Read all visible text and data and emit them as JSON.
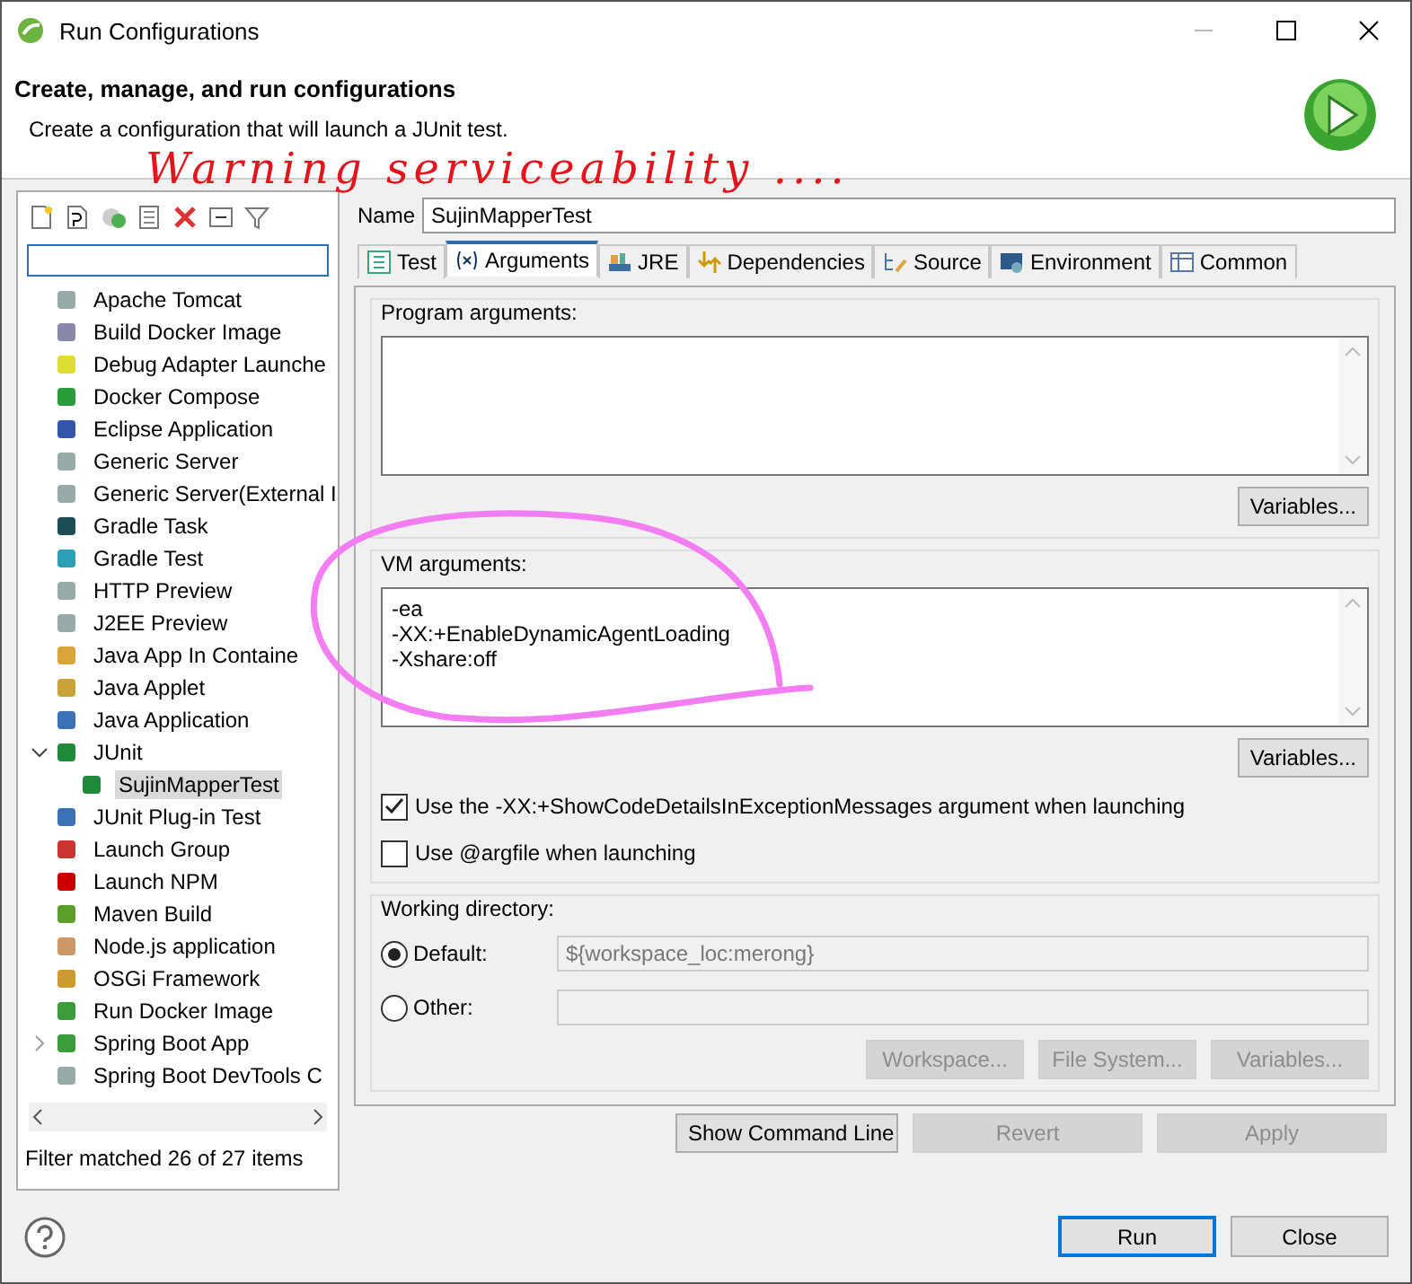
{
  "window": {
    "title": "Run Configurations"
  },
  "header": {
    "title": "Create, manage, and run configurations",
    "subtitle": "Create a configuration that will launch a JUnit test."
  },
  "sidebar": {
    "items": [
      {
        "label": "Apache Tomcat",
        "selected": false
      },
      {
        "label": "Build Docker Image",
        "selected": false
      },
      {
        "label": "Debug Adapter Launche",
        "selected": false
      },
      {
        "label": "Docker Compose",
        "selected": false
      },
      {
        "label": "Eclipse Application",
        "selected": false
      },
      {
        "label": "Generic Server",
        "selected": false
      },
      {
        "label": "Generic Server(External I",
        "selected": false
      },
      {
        "label": "Gradle Task",
        "selected": false
      },
      {
        "label": "Gradle Test",
        "selected": false
      },
      {
        "label": "HTTP Preview",
        "selected": false
      },
      {
        "label": "J2EE Preview",
        "selected": false
      },
      {
        "label": "Java App In Containe",
        "selected": false
      },
      {
        "label": "Java Applet",
        "selected": false
      },
      {
        "label": "Java Application",
        "selected": false
      },
      {
        "label": "JUnit",
        "selected": false,
        "expanded": true,
        "children": [
          {
            "label": "SujinMapperTest",
            "selected": true
          }
        ]
      },
      {
        "label": "JUnit Plug-in Test",
        "selected": false
      },
      {
        "label": "Launch Group",
        "selected": false
      },
      {
        "label": "Launch NPM",
        "selected": false
      },
      {
        "label": "Maven Build",
        "selected": false
      },
      {
        "label": "Node.js application",
        "selected": false
      },
      {
        "label": "OSGi Framework",
        "selected": false
      },
      {
        "label": "Run Docker Image",
        "selected": false
      },
      {
        "label": "Spring Boot App",
        "selected": false,
        "expanded": false
      },
      {
        "label": "Spring Boot DevTools C",
        "selected": false
      }
    ],
    "status": "Filter matched 26 of 27 items"
  },
  "editor": {
    "name_label": "Name",
    "name_value": "SujinMapperTest",
    "tabs": [
      {
        "label": "Test",
        "selected": false
      },
      {
        "label": "Arguments",
        "selected": true
      },
      {
        "label": "JRE",
        "selected": false
      },
      {
        "label": "Dependencies",
        "selected": false
      },
      {
        "label": "Source",
        "selected": false
      },
      {
        "label": "Environment",
        "selected": false
      },
      {
        "label": "Common",
        "selected": false
      }
    ],
    "program_arguments": {
      "label": "Program arguments:",
      "button": "Variables..."
    },
    "vm_arguments": {
      "label": "VM arguments:",
      "value": "-ea\n-XX:+EnableDynamicAgentLoading\n-Xshare:off",
      "button": "Variables..."
    },
    "options": [
      {
        "label": "Use the -XX:+ShowCodeDetailsInExceptionMessages argument when launching",
        "checked": true
      },
      {
        "label": "Use @argfile when launching",
        "checked": false
      }
    ],
    "working_directory": {
      "label": "Working directory:",
      "choices": [
        {
          "label": "Default:",
          "selected": true,
          "value": "${workspace_loc:merong}"
        },
        {
          "label": "Other:",
          "selected": false
        }
      ],
      "buttons": [
        {
          "label": "Workspace...",
          "disabled": true
        },
        {
          "label": "File System...",
          "disabled": true
        },
        {
          "label": "Variables...",
          "disabled": true
        }
      ]
    },
    "buttons": [
      {
        "label": "Show Command Line",
        "disabled": false
      },
      {
        "label": "Revert",
        "disabled": true
      },
      {
        "label": "Apply",
        "disabled": true
      }
    ]
  },
  "footer": {
    "buttons": [
      {
        "label": "Run",
        "default": true
      },
      {
        "label": "Close",
        "default": false
      }
    ]
  },
  "annotations": [
    {
      "kind": "handwriting",
      "text": "Warning serviceability ....",
      "color": "#e3141c"
    },
    {
      "kind": "loop",
      "color": "#f27ef2"
    }
  ]
}
